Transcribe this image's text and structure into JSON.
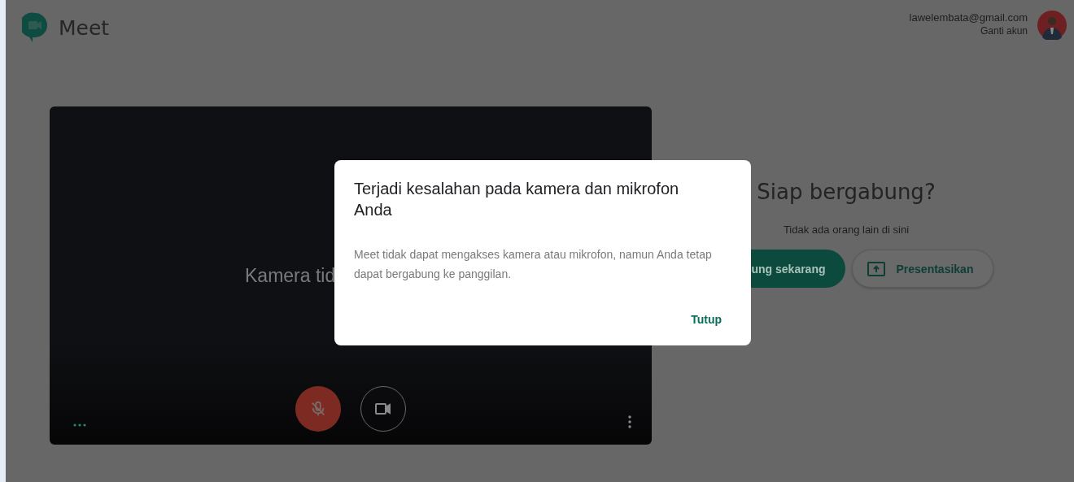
{
  "app": {
    "name": "Meet"
  },
  "account": {
    "email": "lawelembata@gmail.com",
    "switch_label": "Ganti akun"
  },
  "preview": {
    "camera_message": "Kamera tid",
    "mic_muted": true
  },
  "join_panel": {
    "title": "Siap bergabung?",
    "subtitle": "Tidak ada orang lain di sini",
    "join_button": "ung sekarang",
    "present_button": "Presentasikan"
  },
  "dialog": {
    "title": "Terjadi kesalahan pada kamera dan mikrofon Anda",
    "body": "Meet tidak dapat mengakses kamera atau mikrofon, namun Anda tetap dapat bergabung ke panggilan.",
    "close_button": "Tutup"
  }
}
